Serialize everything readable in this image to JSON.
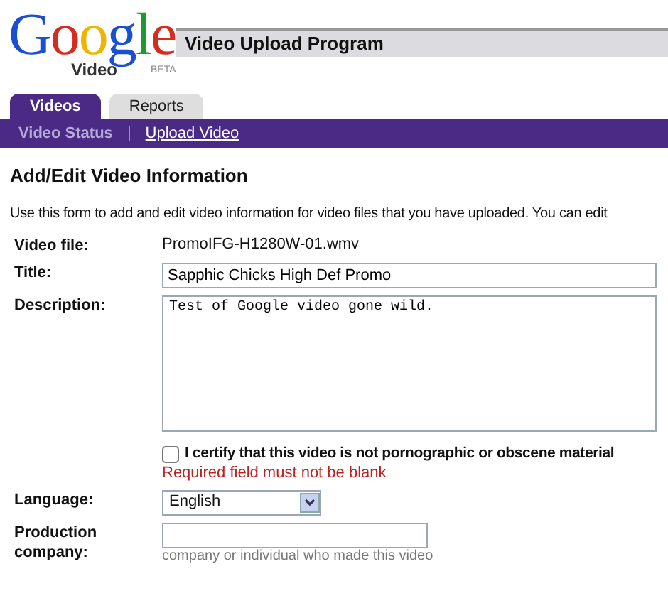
{
  "logo": {
    "word": "Google",
    "sub": "Video",
    "badge": "BETA"
  },
  "program_title": "Video Upload Program",
  "tabs": [
    {
      "label": "Videos",
      "selected": true
    },
    {
      "label": "Reports",
      "selected": false
    }
  ],
  "subnav": [
    {
      "label": "Video Status",
      "selected": true
    },
    {
      "label": "Upload Video",
      "selected": false
    }
  ],
  "subnav_separator": "|",
  "heading": "Add/Edit Video Information",
  "intro": "Use this form to add and edit video information for video files that you have uploaded. You can edit",
  "fields": [
    {
      "kind": "static",
      "label": "Video file:",
      "value": "PromoIFG-H1280W-01.wmv"
    },
    {
      "kind": "text",
      "label": "Title:",
      "value": "Sapphic Chicks High Def Promo"
    },
    {
      "kind": "textarea",
      "label": "Description:",
      "value": "Test of Google video gone wild."
    },
    {
      "kind": "checkbox",
      "text": "I certify that this video is not pornographic or obscene material",
      "checked": false,
      "error": "Required field must not be blank"
    },
    {
      "kind": "select",
      "label": "Language:",
      "value": "English"
    },
    {
      "kind": "short",
      "label": "Production company:",
      "hint": "company or individual who made this video"
    }
  ]
}
